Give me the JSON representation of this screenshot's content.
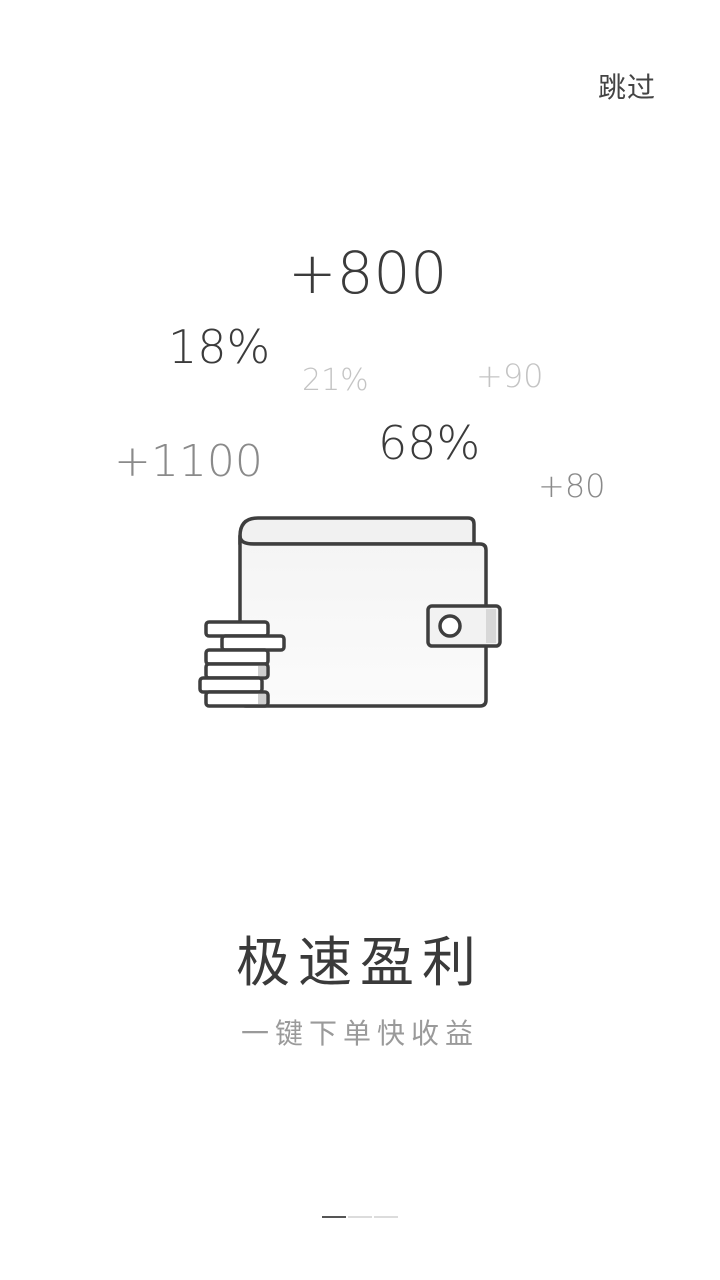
{
  "header": {
    "skip_label": "跳过"
  },
  "floating_values": {
    "v800": "+800",
    "v18": "18%",
    "v21": "21%",
    "v90": "+90",
    "v68": "68%",
    "v1100": "+1100",
    "v80": "+80"
  },
  "illustration": {
    "icon": "wallet-with-coins-icon"
  },
  "content": {
    "title": "极速盈利",
    "subtitle": "一键下单快收益"
  },
  "pager": {
    "total": 3,
    "active_index": 0
  },
  "colors": {
    "text_dark": "#3b3b3b",
    "text_mid": "#8a8a8a",
    "text_light": "#c4c4c4",
    "indicator_active": "#555555",
    "indicator_inactive": "#dcdcdc"
  }
}
